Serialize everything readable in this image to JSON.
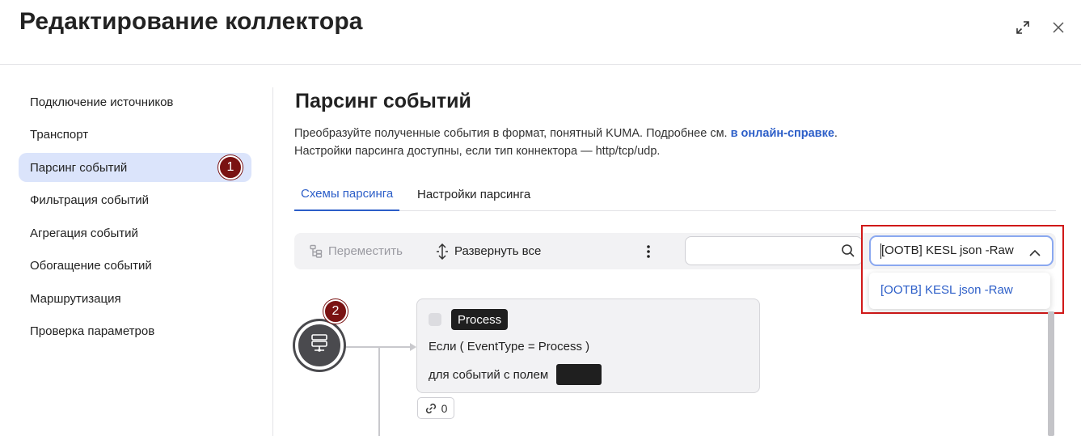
{
  "header": {
    "title": "Редактирование коллектора"
  },
  "sidebar": {
    "items": [
      {
        "label": "Подключение источников"
      },
      {
        "label": "Транспорт"
      },
      {
        "label": "Парсинг событий",
        "active": true
      },
      {
        "label": "Фильтрация событий"
      },
      {
        "label": "Агрегация событий"
      },
      {
        "label": "Обогащение событий"
      },
      {
        "label": "Маршрутизация"
      },
      {
        "label": "Проверка параметров"
      }
    ],
    "marker": "1"
  },
  "main": {
    "title": "Парсинг событий",
    "desc_line1": "Преобразуйте полученные события в формат, понятный KUMA. Подробнее см.",
    "desc_link": "в онлайн-справке",
    "desc_line1_end": ".",
    "desc_line2": "Настройки парсинга доступны, если тип коннектора — http/tcp/udp.",
    "tabs": [
      {
        "label": "Схемы парсинга",
        "active": true
      },
      {
        "label": "Настройки парсинга"
      }
    ]
  },
  "toolbar": {
    "move_label": "Переместить",
    "expand_label": "Развернуть все",
    "search_placeholder": "",
    "select_value": "[OOTB] KESL json -Raw",
    "dropdown_option": "[OOTB] KESL json -Raw"
  },
  "canvas": {
    "marker": "2",
    "node": {
      "name": "Process",
      "condition": "Если ( EventType = Process )",
      "field_label": "для событий с полем"
    },
    "link_count": "0"
  },
  "colors": {
    "accent": "#2c5ec8",
    "active_bg": "#dbe4fb",
    "marker": "#7a1212",
    "highlight": "#d01818"
  }
}
